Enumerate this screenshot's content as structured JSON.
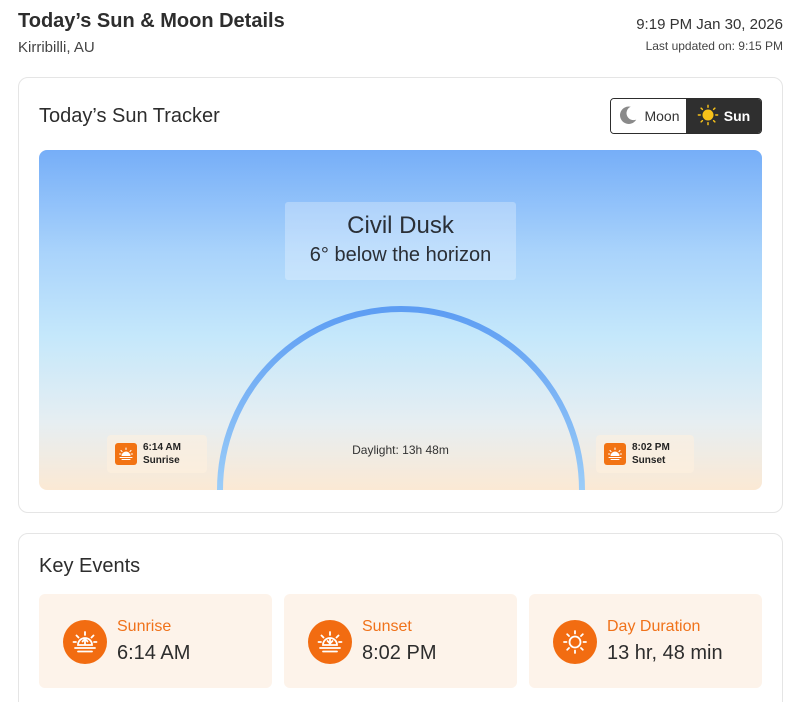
{
  "header": {
    "title": "Today’s Sun & Moon Details",
    "location": "Kirribilli, AU",
    "datetime": "9:19 PM Jan 30, 2026",
    "last_updated": "Last updated on: 9:15 PM"
  },
  "tracker": {
    "title": "Today’s Sun Tracker",
    "toggle": {
      "moon_label": "Moon",
      "sun_label": "Sun",
      "selected": "Sun"
    },
    "phase_name": "Civil Dusk",
    "phase_desc": "6° below the horizon",
    "daylight": "Daylight: 13h 48m",
    "sunrise": {
      "time": "6:14 AM",
      "label": "Sunrise"
    },
    "sunset": {
      "time": "8:02 PM",
      "label": "Sunset"
    }
  },
  "key_events": {
    "title": "Key Events",
    "items": [
      {
        "label": "Sunrise",
        "value": "6:14 AM",
        "icon": "sunrise-icon"
      },
      {
        "label": "Sunset",
        "value": "8:02 PM",
        "icon": "sunset-icon"
      },
      {
        "label": "Day Duration",
        "value": "13 hr, 48 min",
        "icon": "sun-icon"
      }
    ]
  },
  "colors": {
    "accent": "#f26c11",
    "tile_bg": "#fdf3ea",
    "toggle_active": "#2f2f2f",
    "arc": "#6aa8f5"
  }
}
